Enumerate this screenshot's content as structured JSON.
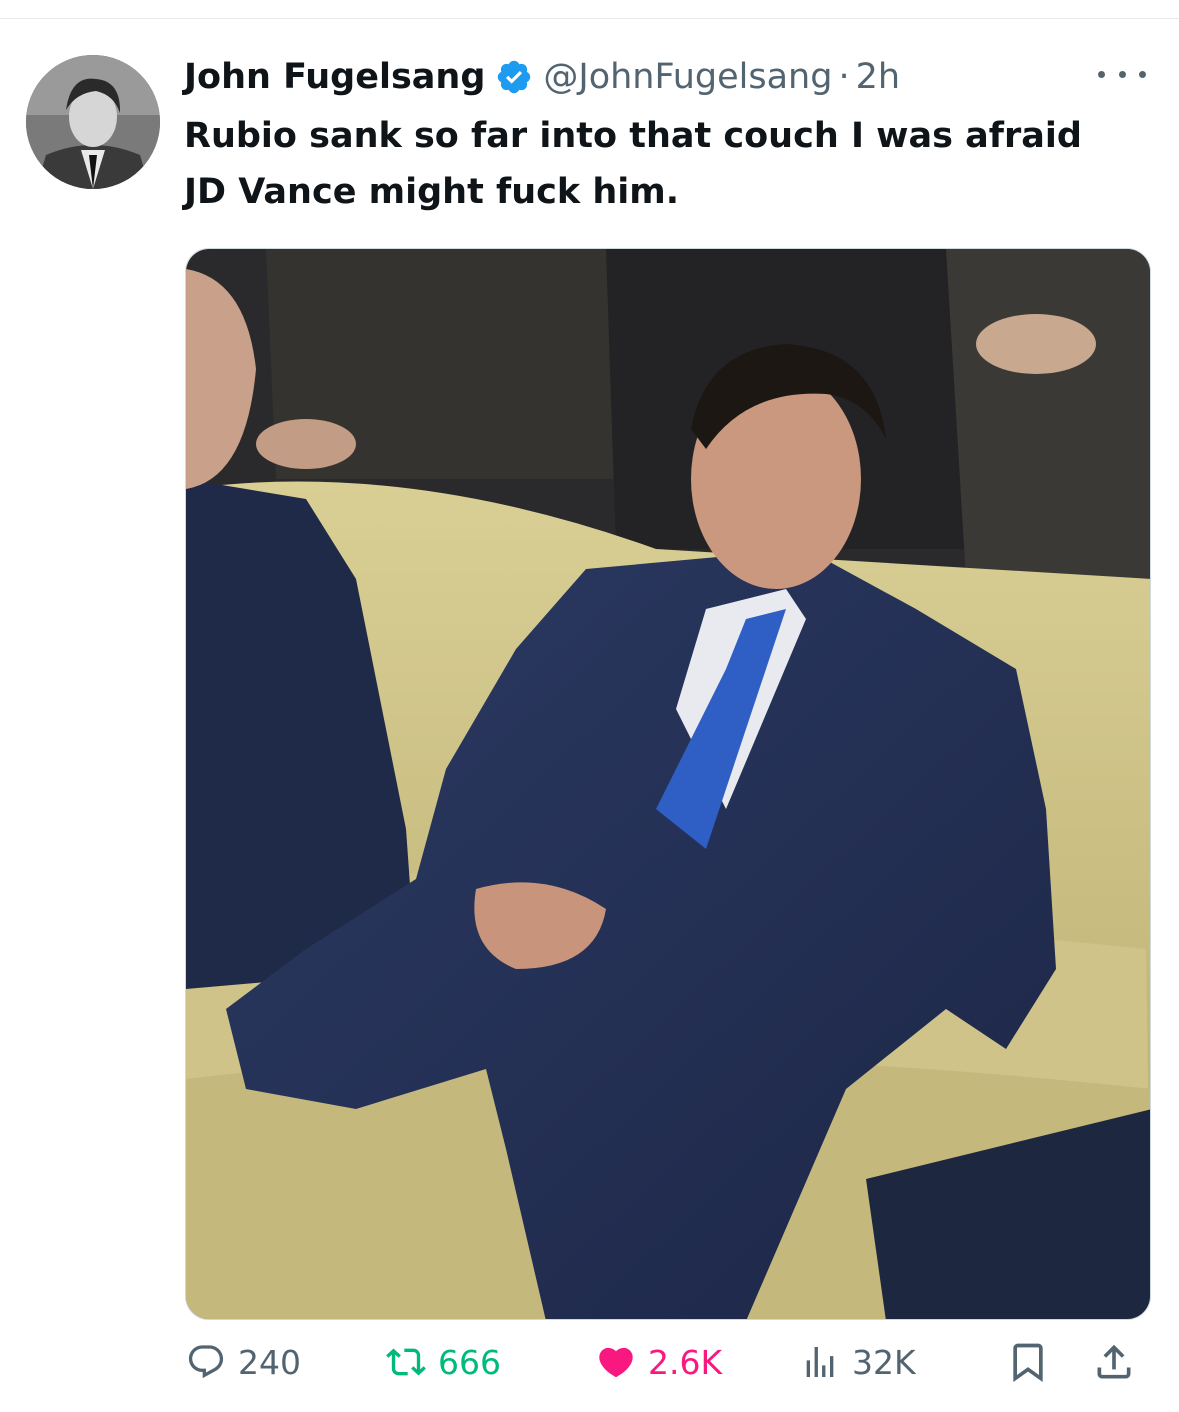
{
  "tweet": {
    "author_name": "John Fugelsang",
    "handle": "@JohnFugelsang",
    "separator": "·",
    "time": "2h",
    "text": "Rubio sank so far into that couch I was afraid JD Vance might fuck him.",
    "verified_color": "#1d9bf0"
  },
  "actions": {
    "reply_count": "240",
    "retweet_count": "666",
    "like_count": "2.6K",
    "views_count": "32K"
  },
  "icons": {
    "reply": "reply-icon",
    "retweet": "retweet-icon",
    "like": "heart-icon",
    "views": "views-icon",
    "bookmark": "bookmark-icon",
    "share": "share-icon",
    "more": "more-icon"
  },
  "colors": {
    "text": "#0f1419",
    "secondary": "#536471",
    "retweet": "#00ba7c",
    "like": "#f91880"
  }
}
